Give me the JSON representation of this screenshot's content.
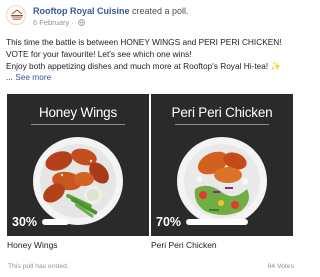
{
  "post": {
    "page_name": "Rooftop Royal Cuisine",
    "action": " created a poll.",
    "date": "6 February · ",
    "avatar_icon": "rooftop-royal-cuisine-logo",
    "privacy_icon": "globe-icon"
  },
  "caption": {
    "line1": "This time the battle is between HONEY WINGS and PERI PERI CHICKEN!",
    "line2": "VOTE for your favourite! Let's see which one wins!",
    "line3": "Enjoy both appetizing dishes and much more at Rooftop's Royal Hi-tea!",
    "sparkle": " ✨",
    "ellipsis": "... ",
    "see_more": "See more"
  },
  "poll": {
    "options": [
      {
        "title": "Honey Wings",
        "percent_label": "30%",
        "percent": 30,
        "label": "Honey Wings",
        "image_icon": "honey-wings-bowl"
      },
      {
        "title": "Peri Peri Chicken",
        "percent_label": "70%",
        "percent": 70,
        "label": "Peri Peri Chicken",
        "image_icon": "peri-peri-chicken-bowl"
      }
    ],
    "status": "This poll has ended.",
    "votes": "64 Votes"
  },
  "colors": {
    "link": "#385898",
    "muted": "#90949c",
    "card_bg": "#2a2a2a"
  }
}
